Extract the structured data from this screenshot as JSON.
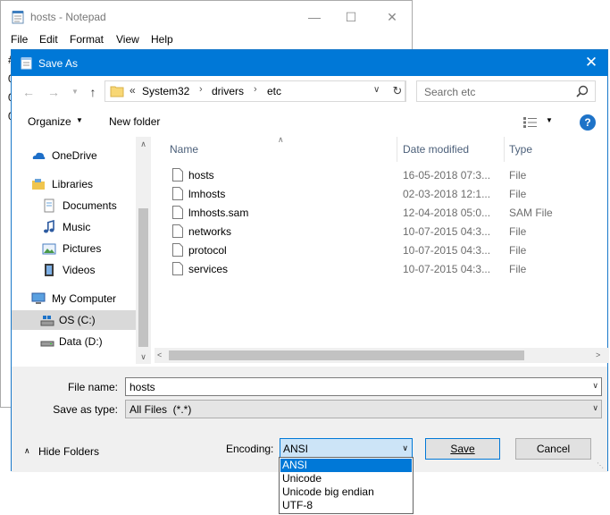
{
  "notepad": {
    "title": "hosts - Notepad",
    "menu": [
      "File",
      "Edit",
      "Format",
      "View",
      "Help"
    ],
    "text_fragment": [
      "#",
      "0",
      "0",
      "0"
    ]
  },
  "dialog": {
    "title": "Save As",
    "breadcrumb": [
      "System32",
      "drivers",
      "etc"
    ],
    "breadcrumb_overflow": "«",
    "search_placeholder": "Search etc",
    "toolbar": {
      "organize": "Organize",
      "new_folder": "New folder"
    },
    "nav_items": [
      {
        "label": "OneDrive",
        "icon": "onedrive-icon"
      },
      {
        "label": "Libraries",
        "icon": "libraries-icon"
      },
      {
        "label": "Documents",
        "icon": "documents-icon"
      },
      {
        "label": "Music",
        "icon": "music-icon"
      },
      {
        "label": "Pictures",
        "icon": "pictures-icon"
      },
      {
        "label": "Videos",
        "icon": "videos-icon"
      },
      {
        "label": "My Computer",
        "icon": "computer-icon"
      },
      {
        "label": "OS (C:)",
        "icon": "drive-c-icon"
      },
      {
        "label": "Data (D:)",
        "icon": "drive-d-icon"
      }
    ],
    "columns": {
      "name": "Name",
      "date_modified": "Date modified",
      "type": "Type"
    },
    "files": [
      {
        "name": "hosts",
        "date": "16-05-2018 07:3...",
        "type": "File"
      },
      {
        "name": "lmhosts",
        "date": "02-03-2018 12:1...",
        "type": "File"
      },
      {
        "name": "lmhosts.sam",
        "date": "12-04-2018 05:0...",
        "type": "SAM File"
      },
      {
        "name": "networks",
        "date": "10-07-2015 04:3...",
        "type": "File"
      },
      {
        "name": "protocol",
        "date": "10-07-2015 04:3...",
        "type": "File"
      },
      {
        "name": "services",
        "date": "10-07-2015 04:3...",
        "type": "File"
      }
    ],
    "form": {
      "file_name_label": "File name:",
      "file_name_value": "hosts",
      "save_type_label": "Save as type:",
      "save_type_value": "All Files  (*.*)",
      "encoding_label": "Encoding:",
      "encoding_value": "ANSI",
      "save_button": "Save",
      "cancel_button": "Cancel",
      "hide_folders": "Hide Folders"
    },
    "encoding_options": [
      "ANSI",
      "Unicode",
      "Unicode big endian",
      "UTF-8"
    ],
    "selected_encoding_index": 0,
    "accent_color": "#0078d7"
  }
}
